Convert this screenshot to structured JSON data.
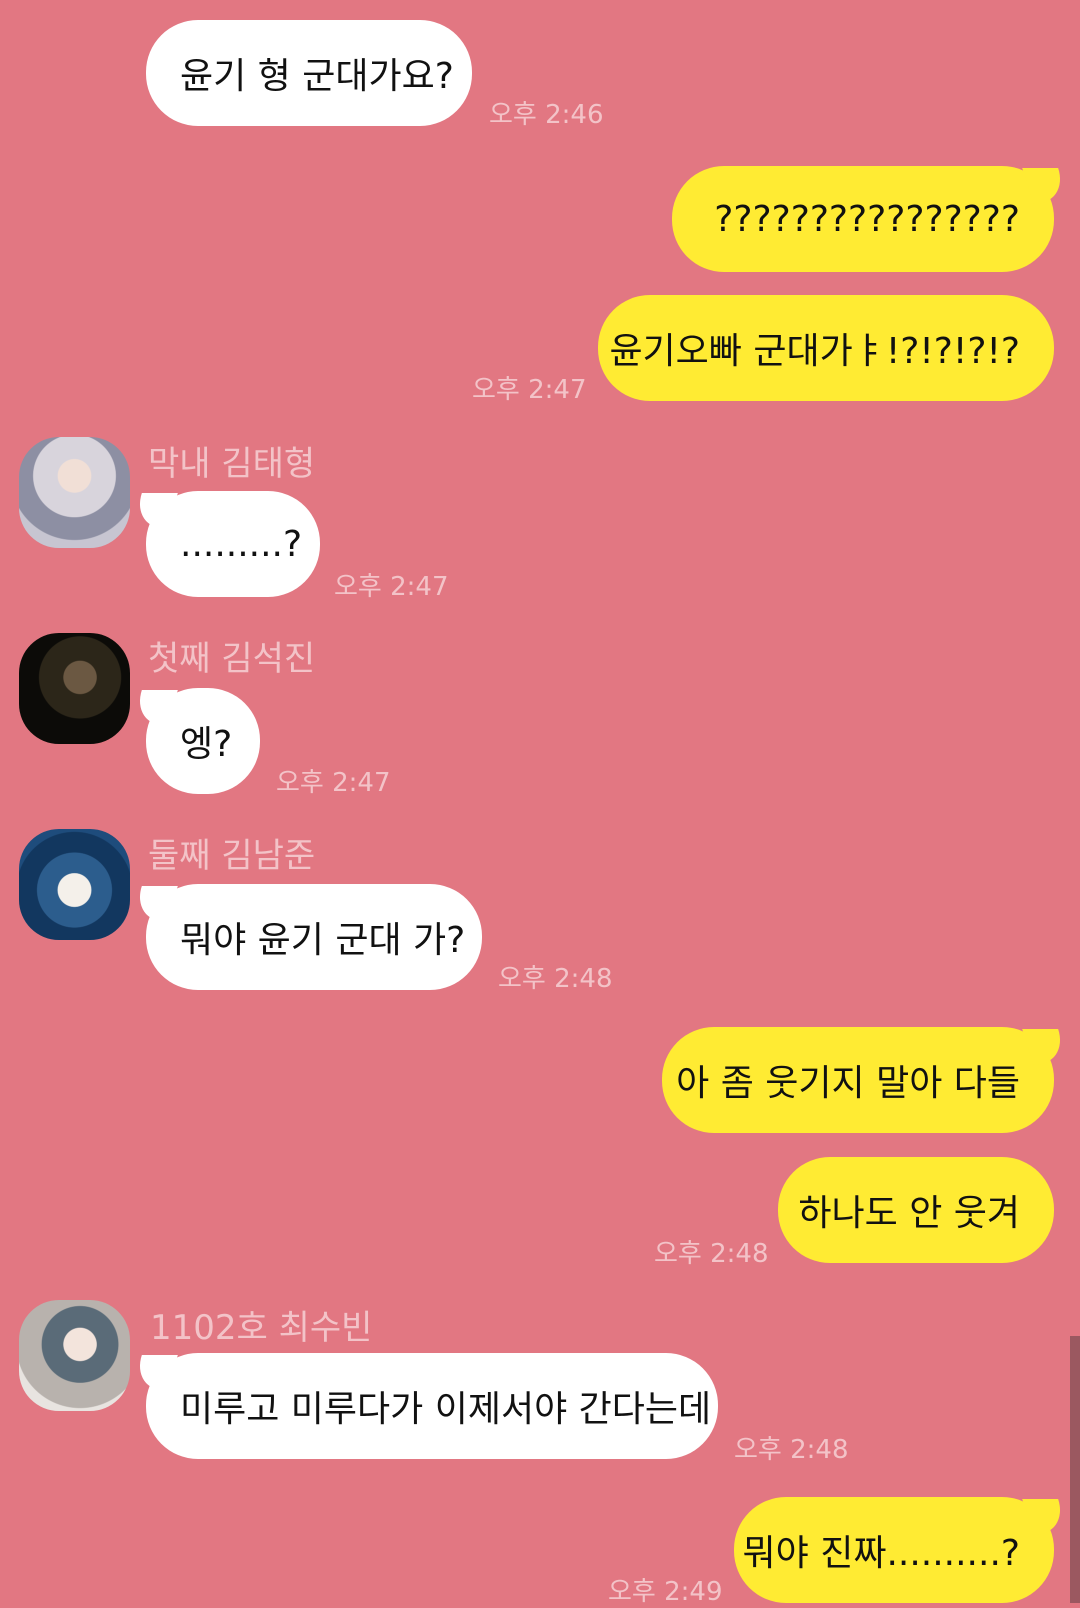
{
  "messages": [
    {
      "text": "윤기 형 군대가요?",
      "time": "오후 2:46"
    },
    {
      "text": "????????????????"
    },
    {
      "text": "윤기오빠 군대가ㅑ!?!?!?!?",
      "time": "오후 2:47"
    },
    {
      "sender": "막내 김태형",
      "text": ".........?",
      "time": "오후 2:47"
    },
    {
      "sender": "첫째 김석진",
      "text": "엥?",
      "time": "오후 2:47"
    },
    {
      "sender": "둘째 김남준",
      "text": "뭐야 윤기 군대 가?",
      "time": "오후 2:48"
    },
    {
      "text": "아 좀 웃기지 말아 다들"
    },
    {
      "text": "하나도 안 웃겨",
      "time": "오후 2:48"
    },
    {
      "sender": "1102호 최수빈",
      "text": "미루고 미루다가 이제서야 간다는데",
      "time": "오후 2:48"
    },
    {
      "text": "뭐야 진짜..........?",
      "time": "오후 2:49"
    }
  ]
}
